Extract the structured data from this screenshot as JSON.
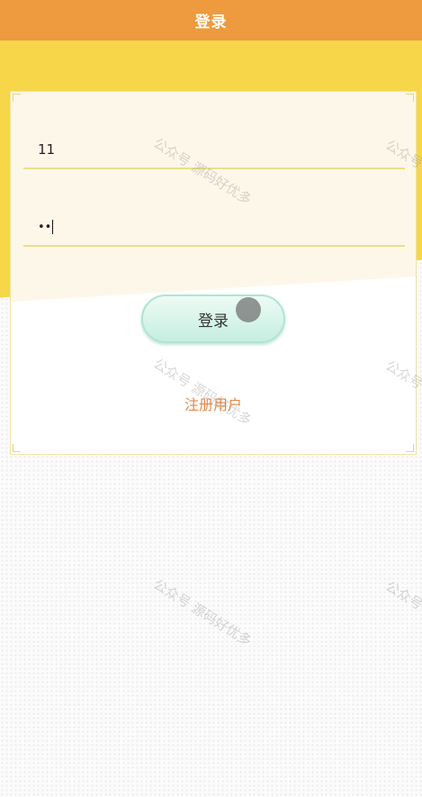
{
  "header": {
    "title": "登录"
  },
  "form": {
    "username_value": "11",
    "password_value": "••",
    "login_button_label": "登录",
    "register_link_label": "注册用户"
  },
  "watermark": {
    "text": "公众号 源码好优多"
  },
  "colors": {
    "header_bg": "#ee9a3e",
    "band_yellow": "#f7d64a",
    "field_underline": "#ecdf85",
    "button_mint": "#c5eee0",
    "link_orange": "#e48a45"
  }
}
